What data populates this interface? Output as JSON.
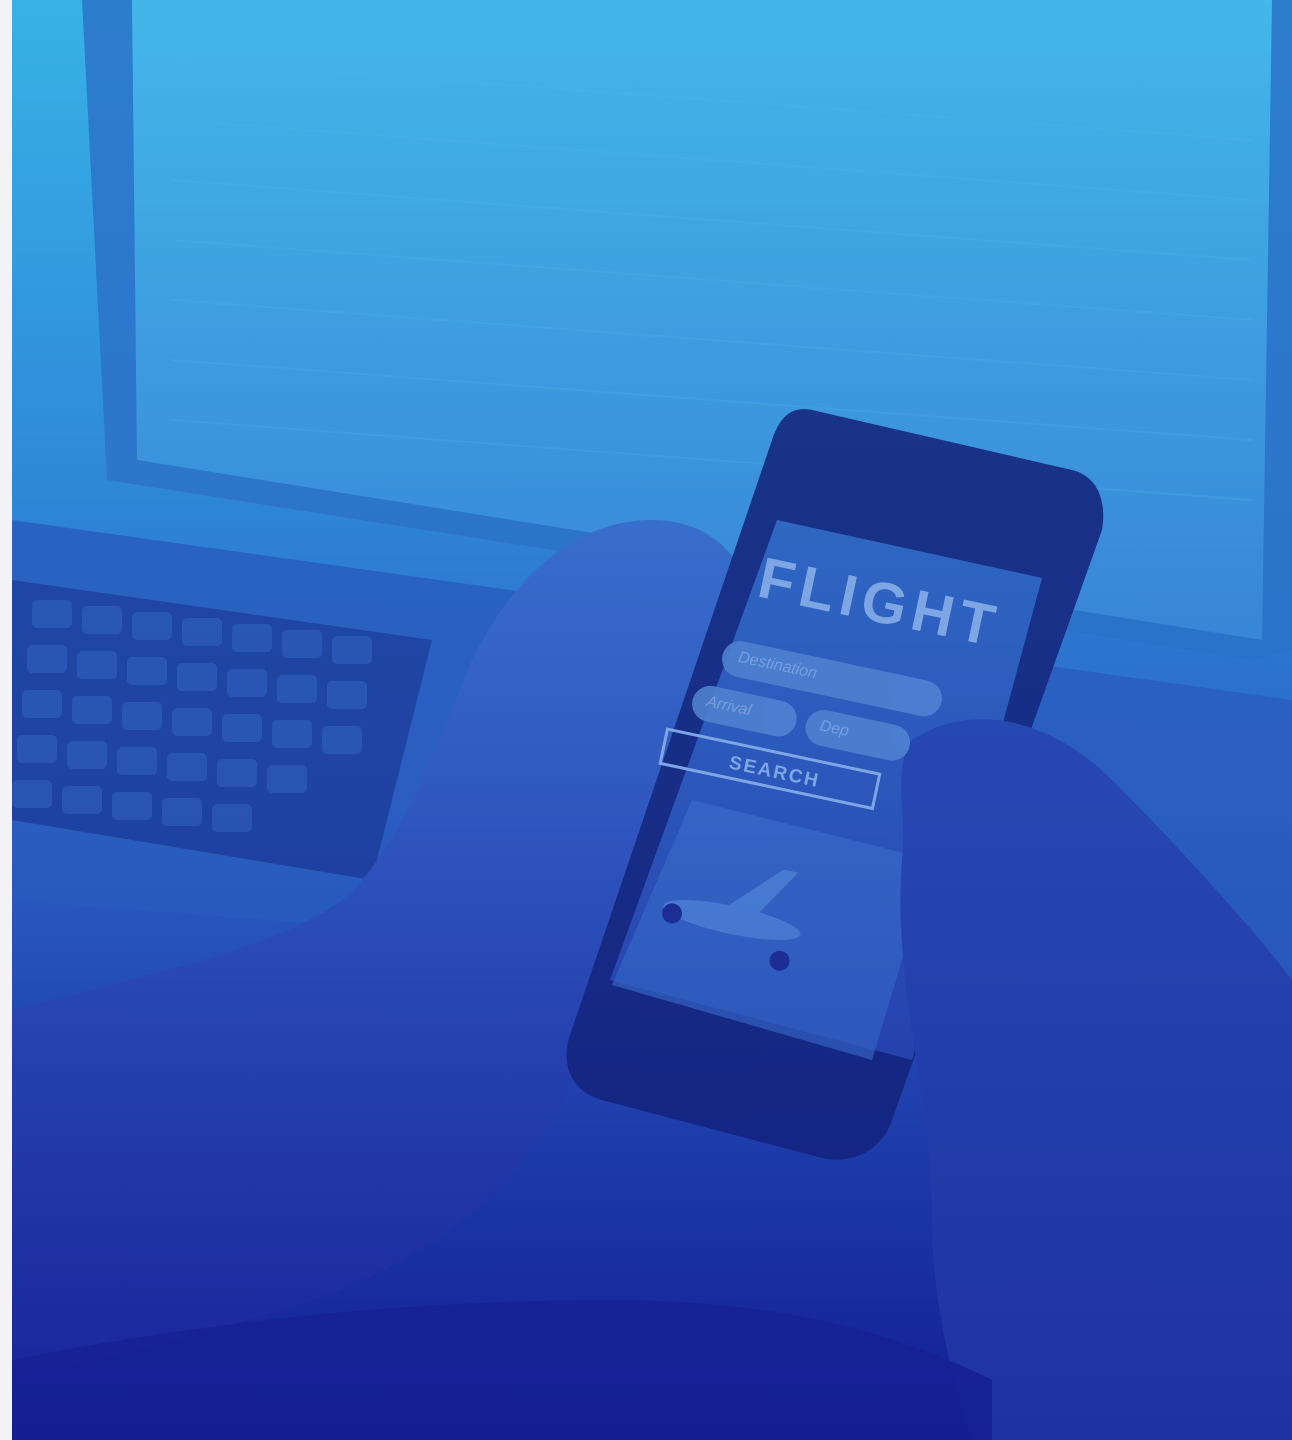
{
  "phone_screen": {
    "title": "FLIGHT",
    "destination_placeholder": "Destination",
    "arrival_placeholder": "Arrival",
    "departure_placeholder": "Dep",
    "search_label": "SEARCH"
  },
  "colors": {
    "gradient_top": "#38b2e6",
    "gradient_bottom": "#14249a"
  }
}
